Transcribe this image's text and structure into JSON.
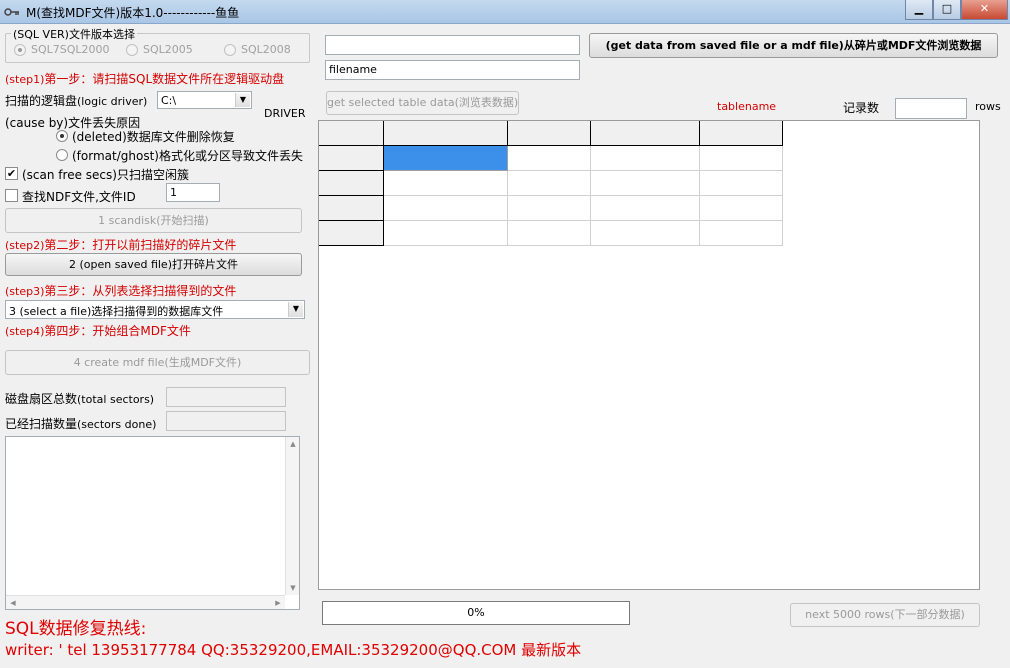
{
  "window": {
    "title": "M(查找MDF文件)版本1.0------------鱼鱼",
    "buttons": {
      "minimize": "▁",
      "maximize": "□",
      "close": "✕"
    }
  },
  "sqlver": {
    "group_label": "(SQL VER)文件版本选择",
    "options": [
      "SQL7SQL2000",
      "SQL2005",
      "SQL2008"
    ],
    "selected_index": 0
  },
  "step1": {
    "prefix": "(step1)",
    "text": "第一步：请扫描SQL数据文件所在逻辑驱动盘",
    "drive_label_cn": "扫描的逻辑盘",
    "drive_label_en": "(logic driver)",
    "drive_value": "C:\\",
    "driver_label": "DRIVER",
    "cause_label": "(cause by)文件丢失原因",
    "cause_options": [
      "(deleted)数据库文件删除恢复",
      "(format/ghost)格式化或分区导致文件丢失"
    ],
    "cause_selected_index": 0,
    "scan_free_label": "(scan free secs)只扫描空闲簇",
    "scan_free_checked": true,
    "ndf_label": "查找NDF文件,文件ID",
    "ndf_checked": false,
    "ndf_value": "1",
    "scan_button": "1 scandisk(开始扫描)"
  },
  "step2": {
    "prefix": "(step2)",
    "text": "第二步：打开以前扫描好的碎片文件",
    "open_button": "2 (open saved file)打开碎片文件"
  },
  "step3": {
    "prefix": "(step3)",
    "text": "第三步：从列表选择扫描得到的文件",
    "select_value": "3 (select a file)选择扫描得到的数据库文件"
  },
  "step4": {
    "prefix": "(step4)",
    "text": "第四步：开始组合MDF文件",
    "create_button": "4 create mdf file(生成MDF文件)"
  },
  "sectors": {
    "total_label_cn": "磁盘扇区总数",
    "total_label_en": "(total sectors)",
    "total_value": "",
    "done_label_cn": "已经扫描数量",
    "done_label_en": "(sectors done)",
    "done_value": ""
  },
  "memo": {
    "text": ""
  },
  "browse": {
    "path_value": "",
    "filename_value": "filename",
    "browse_button": "(get data from saved file or a mdf file)从碎片或MDF文件浏览数据",
    "get_table_button": "get selected table data(浏览表数据)",
    "tablename_label": "tablename",
    "rowcount_label": "记录数",
    "rowcount_value": "",
    "rows_label": "rows"
  },
  "progress": {
    "text": "0%",
    "percent": 0
  },
  "next_button": "next 5000 rows(下一部分数据)",
  "hotline": {
    "title": "SQL数据修复热线:",
    "contact": "writer: ' tel 13953177784 QQ:35329200,EMAIL:35329200@QQ.COM 最新版本"
  },
  "colors": {
    "accent_red": "#d40000",
    "grid_selected": "#3c90ea"
  }
}
